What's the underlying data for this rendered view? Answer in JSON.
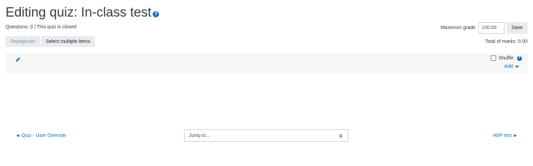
{
  "header": {
    "title": "Editing quiz: In-class test",
    "help_icon": "question-circle-icon"
  },
  "info": {
    "text": "Questions: 0 | This quiz is closed"
  },
  "grade": {
    "label": "Maximum grade",
    "value": "100.00",
    "save_label": "Save"
  },
  "toolbar": {
    "repaginate_label": "Repaginate",
    "select_multiple_label": "Select multiple items"
  },
  "total_marks": "Total of marks: 0.00",
  "section": {
    "edit_icon": "pencil-icon",
    "shuffle_label": "Shuffle",
    "add_label": "Add"
  },
  "navigation": {
    "prev_link": "◄ Quiz - User Override",
    "jump_placeholder": "Jump to...",
    "next_link": "H5P test ►"
  },
  "colors": {
    "link": "#0f6fc5",
    "button_bg": "#e9ecef",
    "section_bg": "#f7f7f7"
  }
}
